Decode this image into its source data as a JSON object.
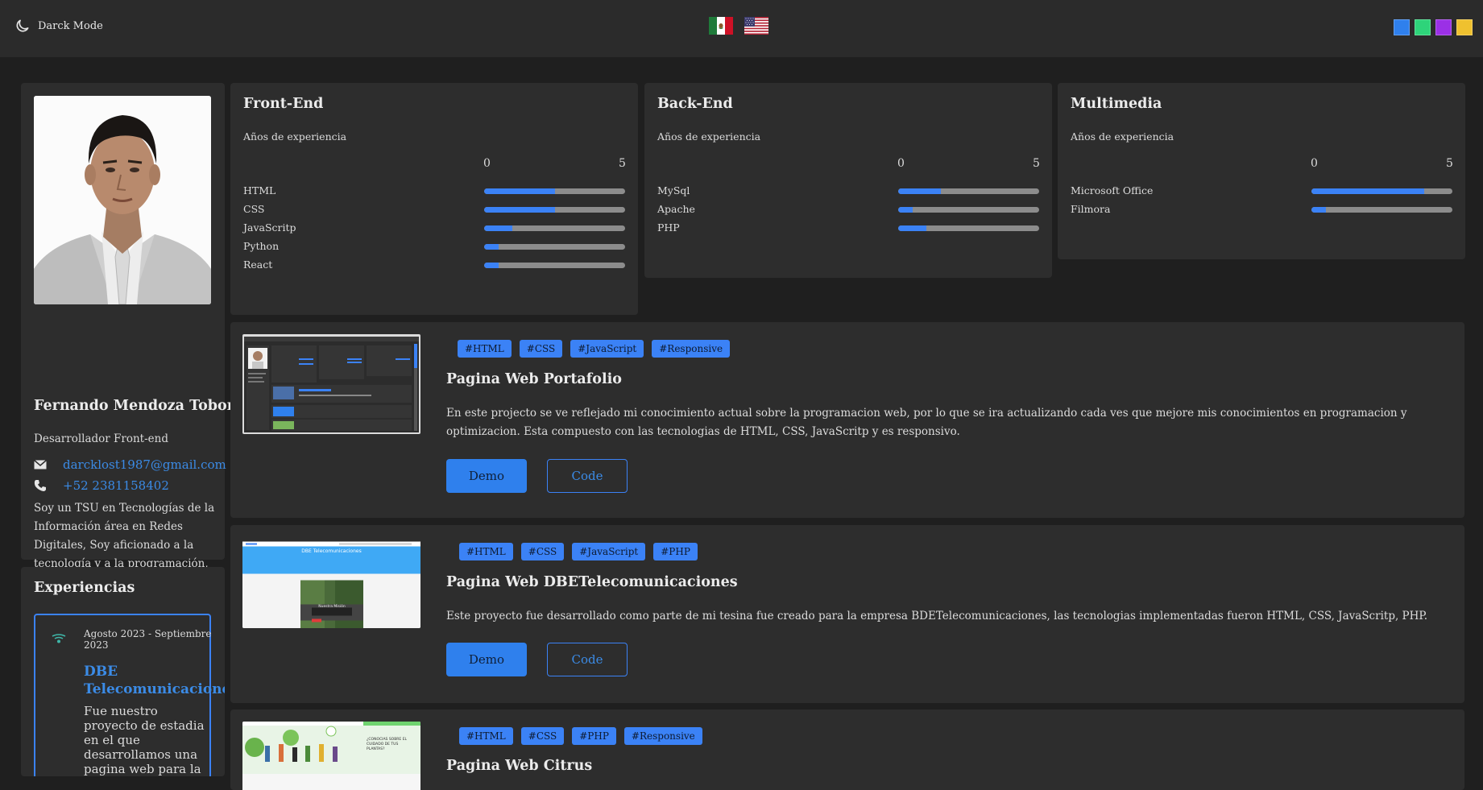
{
  "header": {
    "dark_mode_label": "Darck Mode",
    "languages": [
      {
        "code": "es",
        "icon": "mexico-flag-icon"
      },
      {
        "code": "en",
        "icon": "usa-flag-icon"
      }
    ],
    "theme_colors": [
      "#2f80ed",
      "#2ed47a",
      "#9b30e6",
      "#efc12f"
    ]
  },
  "profile": {
    "name": "Fernando Mendoza Tobon",
    "role": "Desarrollador Front-end",
    "email": "darcklost1987@gmail.com",
    "phone": "+52 2381158402",
    "bio": "Soy un TSU en Tecnologías de la Información área en Redes Digitales, Soy aficionado a la tecnología y a la programación, planteo la posibilidad de crecer en el conocimiento en ciberseguridad y el area de desarrollo web."
  },
  "experience": {
    "title": "Experiencias",
    "items": [
      {
        "date": "Agosto 2023 - Septiembre 2023",
        "company": "DBE Telecomunicaciones",
        "description": "Fue nuestro proyecto de estadia en el que desarrollamos una pagina web para la empresa BDE"
      }
    ]
  },
  "skills": [
    {
      "title": "Front-End",
      "subtitle": "Años de experiencia",
      "scale_min": "0",
      "scale_max": "5",
      "items": [
        {
          "name": "HTML",
          "level": 0.5
        },
        {
          "name": "CSS",
          "level": 0.5
        },
        {
          "name": "JavaScritp",
          "level": 0.2
        },
        {
          "name": "Python",
          "level": 0.1
        },
        {
          "name": "React",
          "level": 0.1
        }
      ]
    },
    {
      "title": "Back-End",
      "subtitle": "Años de experiencia",
      "scale_min": "0",
      "scale_max": "5",
      "items": [
        {
          "name": "MySql",
          "level": 0.3
        },
        {
          "name": "Apache",
          "level": 0.1
        },
        {
          "name": "PHP",
          "level": 0.2
        }
      ]
    },
    {
      "title": "Multimedia",
      "subtitle": "Años de experiencia",
      "scale_min": "0",
      "scale_max": "5",
      "items": [
        {
          "name": "Microsoft Office",
          "level": 0.8
        },
        {
          "name": "Filmora",
          "level": 0.1
        }
      ]
    }
  ],
  "projects": [
    {
      "tags": [
        "#HTML",
        "#CSS",
        "#JavaScript",
        "#Responsive"
      ],
      "title": "Pagina Web Portafolio",
      "description": "En este projecto se ve reflejado mi conocimiento actual sobre la programacion web, por lo que se ira actualizando cada ves que mejore mis conocimientos en programacion y optimizacion. Esta compuesto con las tecnologias de HTML, CSS, JavaScritp y es responsivo.",
      "demo_label": "Demo",
      "code_label": "Code"
    },
    {
      "tags": [
        "#HTML",
        "#CSS",
        "#JavaScript",
        "#PHP"
      ],
      "title": "Pagina Web DBETelecomunicaciones",
      "description": "Este proyecto fue desarrollado como parte de mi tesina fue creado para la empresa BDETelecomunicaciones, las tecnologias implementadas fueron HTML, CSS, JavaScritp, PHP.",
      "demo_label": "Demo",
      "code_label": "Code",
      "thumb_title": "DBE Telecomunicaciones",
      "thumb_button": "Nuestra Misión"
    },
    {
      "tags": [
        "#HTML",
        "#CSS",
        "#PHP",
        "#Responsive"
      ],
      "title": "Pagina Web Citrus",
      "thumb_text": "¿CONOCIAS SOBRE EL CUIDADO DE TUS PLANTAS?"
    }
  ]
}
